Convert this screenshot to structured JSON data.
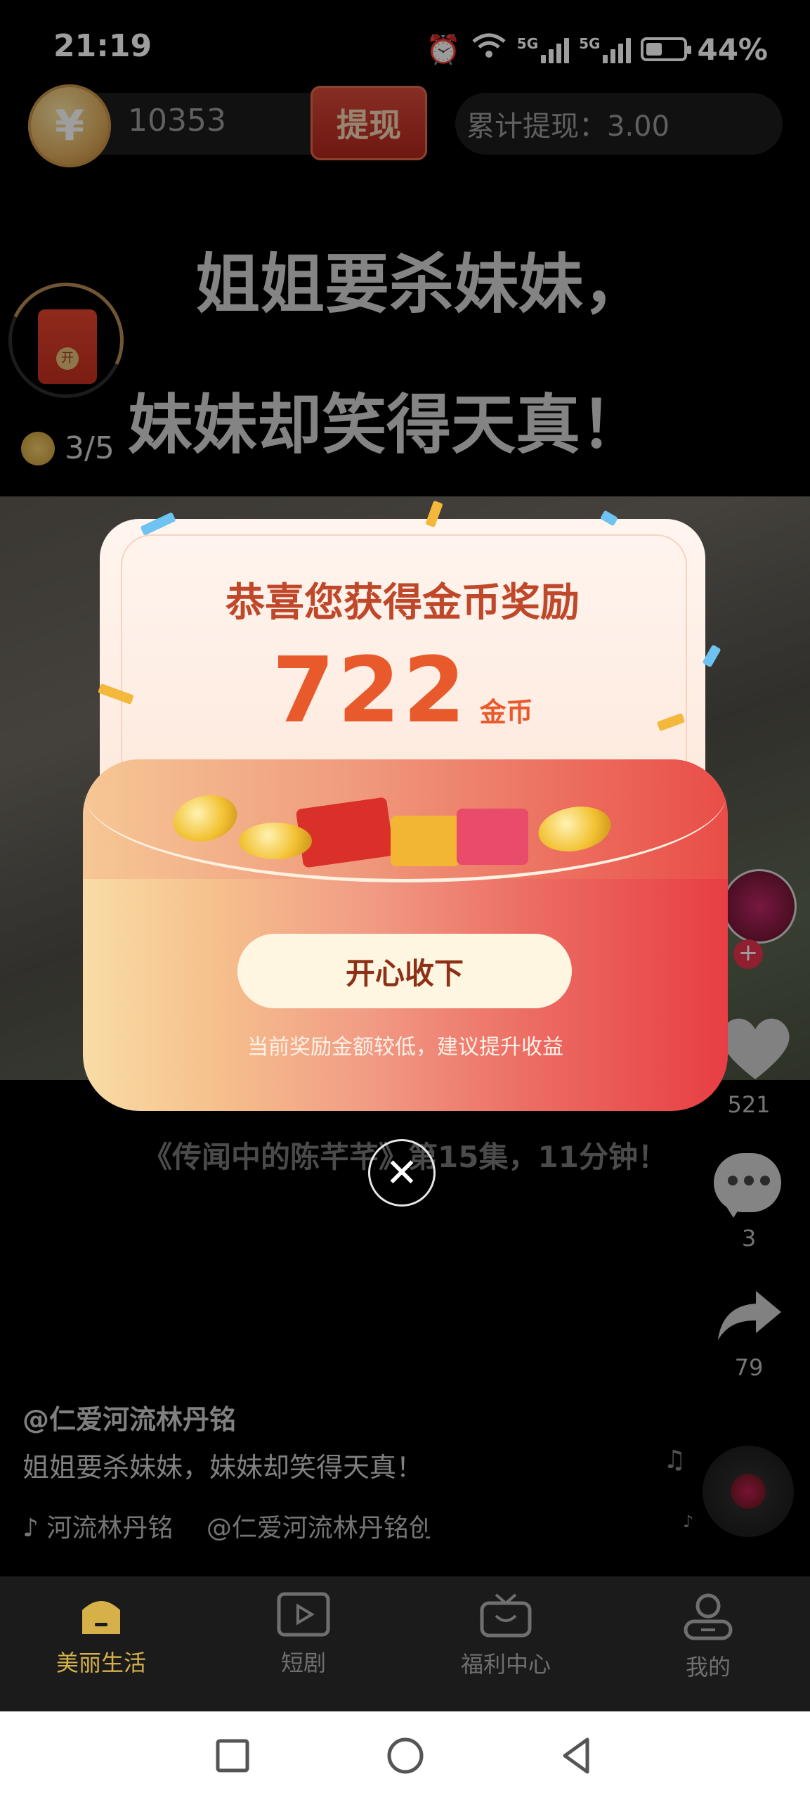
{
  "status": {
    "time": "21:19",
    "battery": "44%",
    "net1": "5G",
    "net2": "5G",
    "battery_level": 0.44
  },
  "coin_bar": {
    "coin_symbol": "¥",
    "coins": "10353",
    "withdraw_label": "提现",
    "total_withdraw": "累计提现：3.00"
  },
  "subtitles": {
    "line1": "姐姐要杀妹妹，",
    "line2": "妹妹却笑得天真！"
  },
  "red_packet": {
    "seal": "开",
    "progress": "3/5"
  },
  "popup": {
    "title": "恭喜您获得金币奖励",
    "amount": "722",
    "unit": "金币",
    "accept_label": "开心收下",
    "hint": "当前奖励金额较低，建议提升收益",
    "close_symbol": "✕"
  },
  "video": {
    "episode_line": "《传闻中的陈芊芊》第15集，11分钟！"
  },
  "rail": {
    "likes": "521",
    "comments": "3",
    "shares": "79",
    "plus": "+"
  },
  "post": {
    "author": "@仁爱河流林丹铭",
    "caption": "姐姐要杀妹妹，妹妹却笑得天真！",
    "music": "♪ 河流林丹铭　 @仁爱河流林丹铭创"
  },
  "tabs": [
    {
      "label": "美丽生活",
      "icon": "home-icon",
      "active": true
    },
    {
      "label": "短剧",
      "icon": "play-icon",
      "active": false
    },
    {
      "label": "福利中心",
      "icon": "tv-gift-icon",
      "active": false
    },
    {
      "label": "我的",
      "icon": "profile-icon",
      "active": false
    }
  ],
  "colors": {
    "accent": "#d6b14a",
    "popup_red": "#e83e43",
    "amount": "#e85a2c"
  }
}
